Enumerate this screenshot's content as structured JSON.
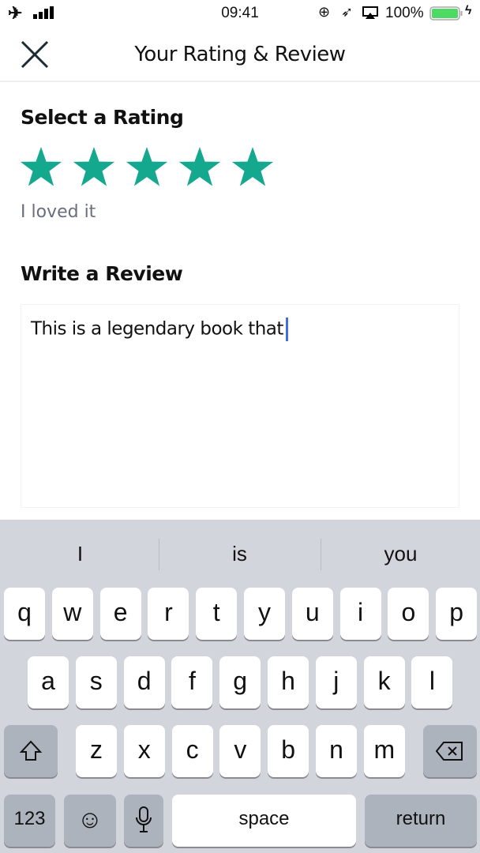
{
  "status": {
    "time": "09:41",
    "battery": "100%",
    "icons": [
      "airplane-icon",
      "signal-icon",
      "rotation-lock-icon",
      "location-icon",
      "airplay-icon",
      "battery-icon",
      "charging-icon"
    ]
  },
  "header": {
    "title": "Your Rating & Review",
    "close_icon": "close-icon"
  },
  "rating": {
    "heading": "Select a Rating",
    "value": 5,
    "max": 5,
    "label": "I loved it",
    "color": "#14a88e"
  },
  "review": {
    "heading": "Write a Review",
    "text": "This is a legendary book that"
  },
  "keyboard": {
    "suggestions": [
      "I",
      "is",
      "you"
    ],
    "row1": [
      "q",
      "w",
      "e",
      "r",
      "t",
      "y",
      "u",
      "i",
      "o",
      "p"
    ],
    "row2": [
      "a",
      "s",
      "d",
      "f",
      "g",
      "h",
      "j",
      "k",
      "l"
    ],
    "row3": [
      "z",
      "x",
      "c",
      "v",
      "b",
      "n",
      "m"
    ],
    "numbers": "123",
    "space": "space",
    "return": "return"
  }
}
